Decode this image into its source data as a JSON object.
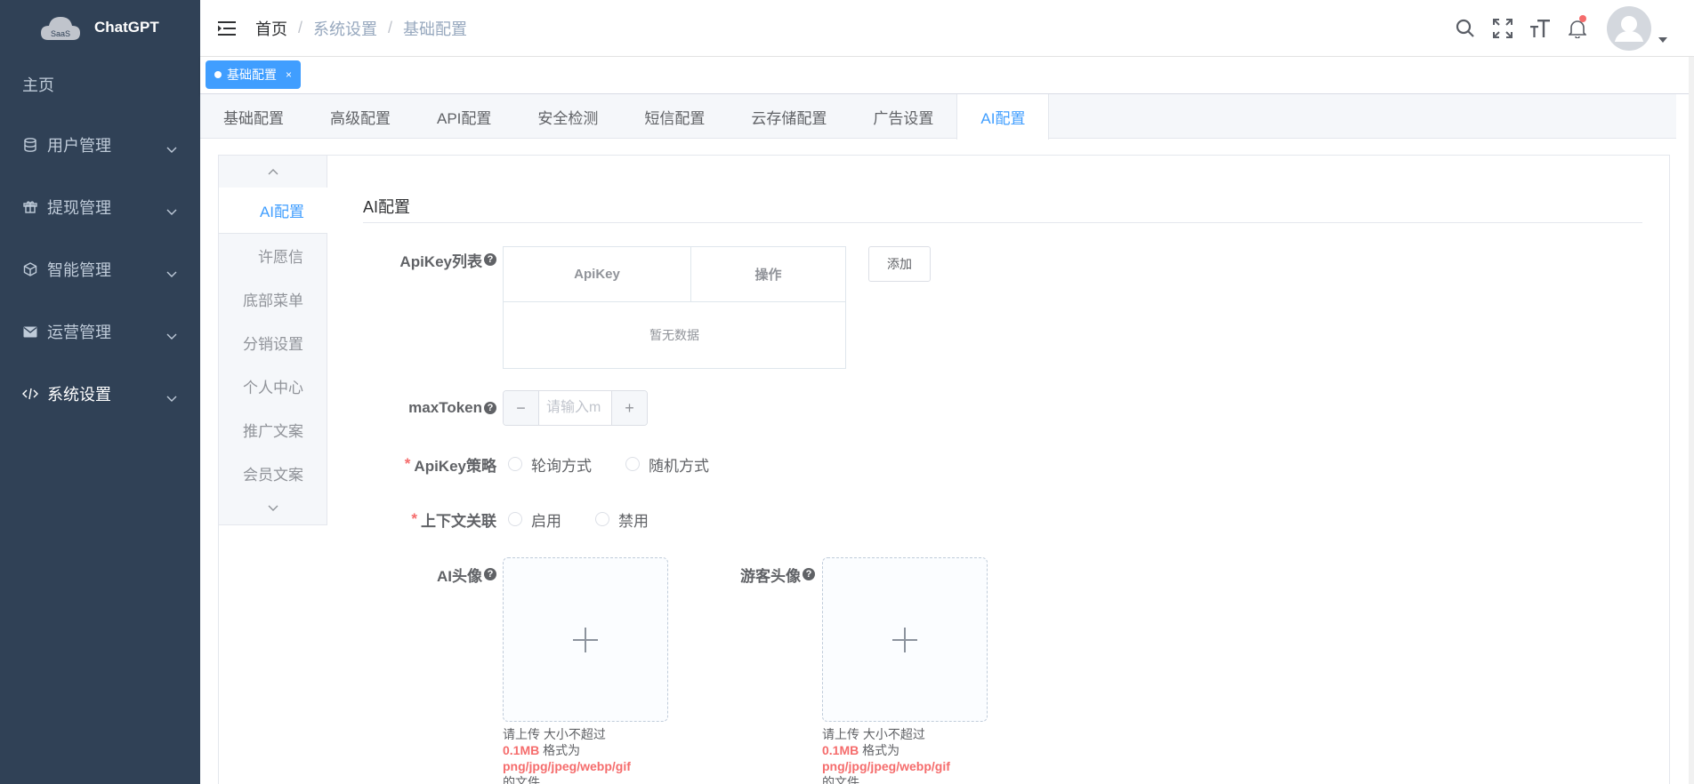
{
  "app": {
    "name": "ChatGPT",
    "logo_badge": "SaaS"
  },
  "sidebar": {
    "items": [
      {
        "label": "主页",
        "icon": "home",
        "has_children": false
      },
      {
        "label": "用户管理",
        "icon": "database-icon",
        "has_children": true
      },
      {
        "label": "提现管理",
        "icon": "gift-icon",
        "has_children": true
      },
      {
        "label": "智能管理",
        "icon": "box-icon",
        "has_children": true
      },
      {
        "label": "运营管理",
        "icon": "mail-icon",
        "has_children": true
      },
      {
        "label": "系统设置",
        "icon": "code-icon",
        "has_children": true,
        "active": true
      }
    ]
  },
  "breadcrumb": [
    "首页",
    "系统设置",
    "基础配置"
  ],
  "tags": [
    {
      "label": "基础配置",
      "active": true
    }
  ],
  "top_tabs": [
    "基础配置",
    "高级配置",
    "API配置",
    "安全检测",
    "短信配置",
    "云存储配置",
    "广告设置",
    "AI配置"
  ],
  "top_tabs_active": "AI配置",
  "side_tabs": [
    "AI配置",
    "许愿信",
    "底部菜单",
    "分销设置",
    "个人中心",
    "推广文案",
    "会员文案"
  ],
  "side_tabs_active": "AI配置",
  "section": {
    "title": "AI配置"
  },
  "form": {
    "apikey_list": {
      "label": "ApiKey列表",
      "columns": [
        "ApiKey",
        "操作"
      ],
      "empty_text": "暂无数据",
      "add_button": "添加"
    },
    "max_token": {
      "label": "maxToken",
      "placeholder": "请输入m",
      "value": ""
    },
    "apikey_strategy": {
      "label": "ApiKey策略",
      "required": true,
      "options": [
        "轮询方式",
        "随机方式"
      ]
    },
    "context": {
      "label": "上下文关联",
      "required": true,
      "options": [
        "启用",
        "禁用"
      ]
    },
    "ai_avatar": {
      "label": "AI头像",
      "tip_line1": "请上传 大小不超过",
      "tip_size": "0.1MB",
      "tip_format_prefix": " 格式为",
      "tip_formats": "png/jpg/jpeg/webp/gif",
      "tip_tail": "的文件"
    },
    "guest_avatar": {
      "label": "游客头像",
      "tip_line1": "请上传 大小不超过",
      "tip_size": "0.1MB",
      "tip_format_prefix": " 格式为",
      "tip_formats": "png/jpg/jpeg/webp/gif",
      "tip_tail": "的文件"
    }
  },
  "colors": {
    "sidebar_bg": "#304156",
    "primary": "#409eff",
    "required": "#f56c6c"
  }
}
